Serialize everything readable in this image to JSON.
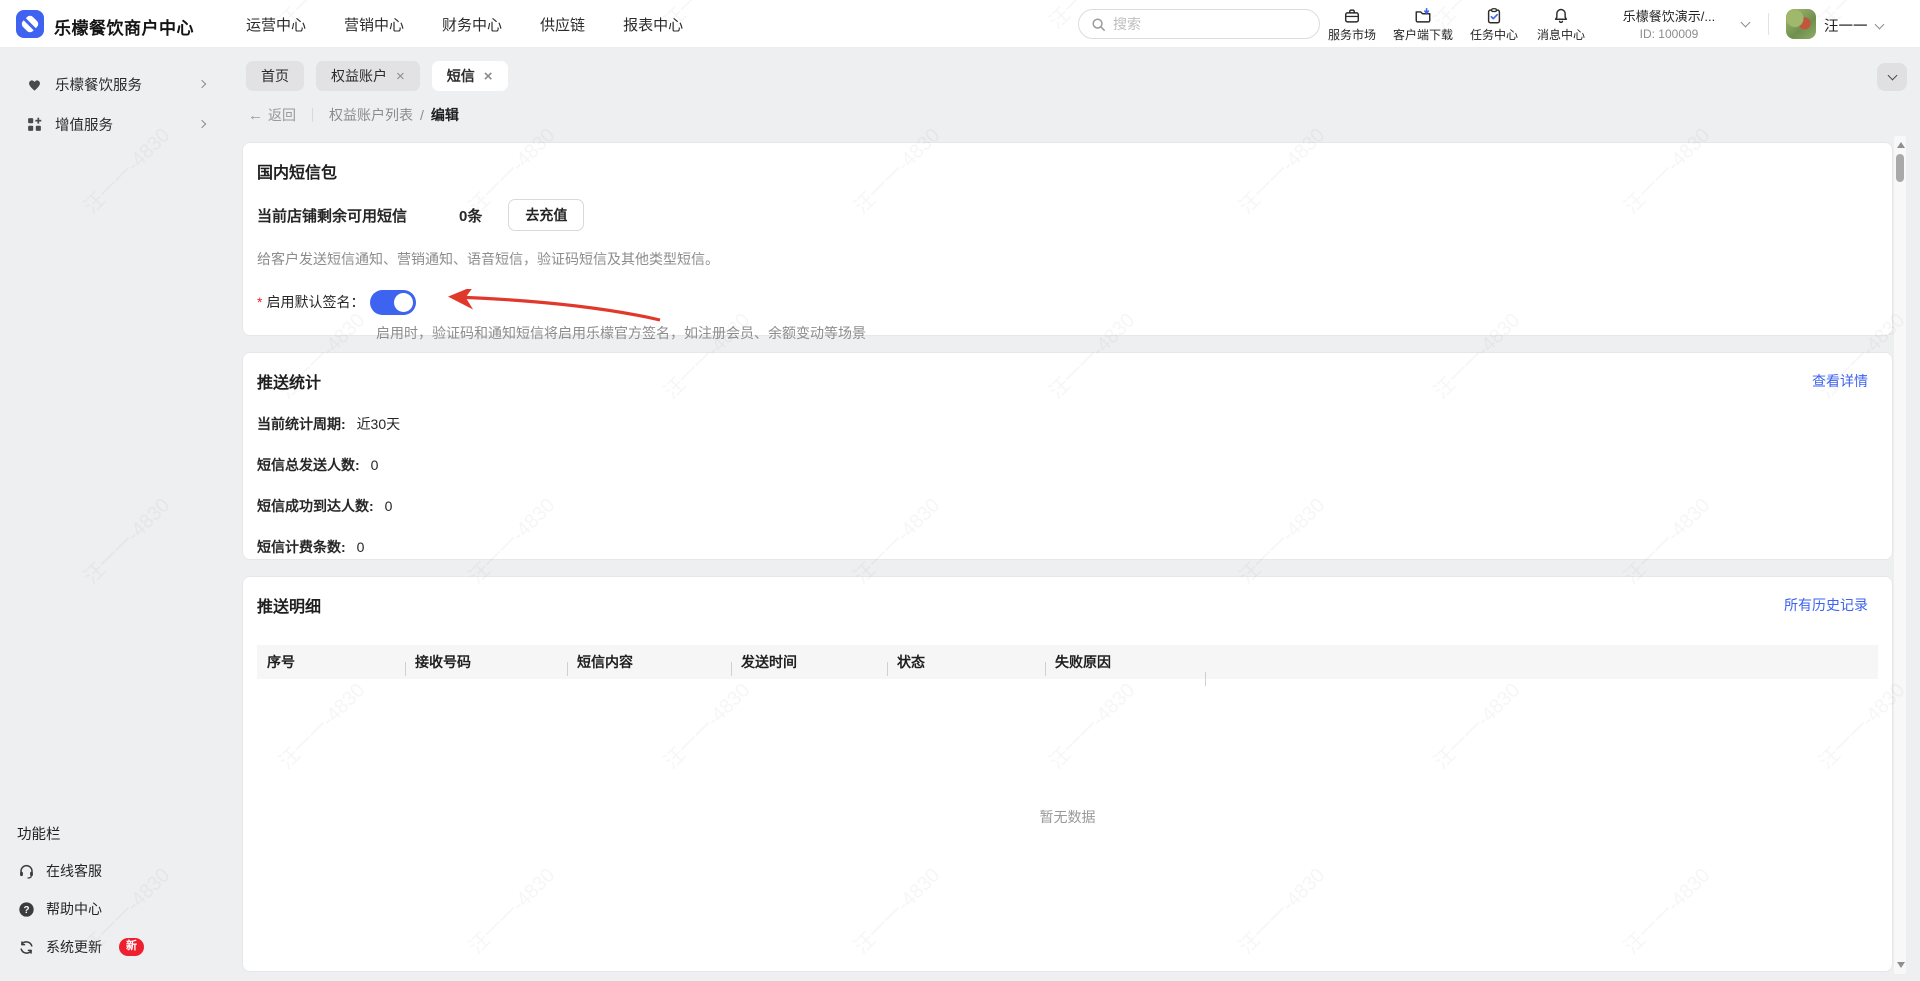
{
  "navbar": {
    "brand": "乐檬餐饮商户中心",
    "menu": [
      "运营中心",
      "营销中心",
      "财务中心",
      "供应链",
      "报表中心"
    ],
    "search": {
      "placeholder": "搜索"
    },
    "quick_actions": [
      {
        "label": "服务市场",
        "icon": "briefcase-icon"
      },
      {
        "label": "客户端下载",
        "icon": "download-icon"
      },
      {
        "label": "任务中心",
        "icon": "task-icon"
      },
      {
        "label": "消息中心",
        "icon": "bell-icon"
      }
    ],
    "merchant": {
      "name": "乐檬餐饮演示/...",
      "id": "ID: 100009"
    },
    "user": {
      "name": "汪一一"
    }
  },
  "sidebar": {
    "items": [
      {
        "label": "乐檬餐饮服务",
        "icon": "heart-service-icon"
      },
      {
        "label": "增值服务",
        "icon": "grid-plus-icon"
      }
    ],
    "footer": {
      "title": "功能栏",
      "items": [
        {
          "label": "在线客服",
          "icon": "headset-icon"
        },
        {
          "label": "帮助中心",
          "icon": "help-icon"
        },
        {
          "label": "系统更新",
          "icon": "refresh-icon",
          "badge": "新"
        }
      ]
    }
  },
  "tabs": [
    {
      "label": "首页",
      "closable": false,
      "active": false
    },
    {
      "label": "权益账户",
      "closable": true,
      "active": false
    },
    {
      "label": "短信",
      "closable": true,
      "active": true
    }
  ],
  "breadcrumb": {
    "back": "返回",
    "parent": "权益账户列表",
    "separator": "/",
    "current": "编辑"
  },
  "sms_card": {
    "title": "国内短信包",
    "balance_label": "当前店铺剩余可用短信",
    "balance_value": "0条",
    "recharge_button": "去充值",
    "description": "给客户发送短信通知、营销通知、语音短信，验证码短信及其他类型短信。",
    "signature": {
      "required_mark": "*",
      "label": "启用默认签名：",
      "enabled": true,
      "helper": "启用时，验证码和通知短信将启用乐檬官方签名，如注册会员、余额变动等场景"
    }
  },
  "stats_card": {
    "title": "推送统计",
    "link": "查看详情",
    "rows": [
      {
        "label": "当前统计周期:",
        "value": "近30天"
      },
      {
        "label": "短信总发送人数:",
        "value": "0"
      },
      {
        "label": "短信成功到达人数:",
        "value": "0"
      },
      {
        "label": "短信计费条数:",
        "value": "0"
      }
    ]
  },
  "detail_card": {
    "title": "推送明细",
    "link": "所有历史记录",
    "columns": [
      "序号",
      "接收号码",
      "短信内容",
      "发送时间",
      "状态",
      "失败原因"
    ],
    "empty_text": "暂无数据"
  },
  "watermark": "汪一一-4830",
  "colors": {
    "accent": "#3d63f0",
    "link": "#3d63f0",
    "danger": "#e03a2b",
    "badge": "#ee1f2f"
  }
}
